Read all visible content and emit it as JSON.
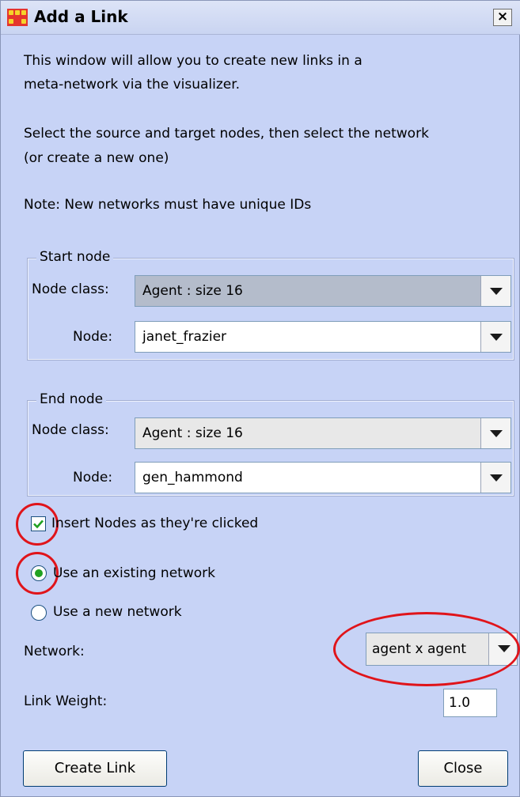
{
  "window": {
    "title": "Add a Link",
    "close_glyph": "×"
  },
  "intro": {
    "line1": "This window will allow you to create new links in a",
    "line2": "meta-network via the visualizer.",
    "line3": "Select the source and target nodes, then select the network",
    "line4": "(or create a new one)",
    "note": "Note: New networks must have unique IDs"
  },
  "start_node": {
    "title": "Start node",
    "class_label": "Node class:",
    "class_value": "Agent : size 16",
    "node_label": "Node:",
    "node_value": "janet_frazier"
  },
  "end_node": {
    "title": "End node",
    "class_label": "Node class:",
    "class_value": "Agent : size 16",
    "node_label": "Node:",
    "node_value": "gen_hammond"
  },
  "options": {
    "insert_label": "Insert Nodes as they're clicked",
    "insert_checked": true,
    "existing_label": "Use an existing network",
    "new_label": "Use a new network",
    "selected": "existing"
  },
  "network": {
    "label": "Network:",
    "value": "agent x agent"
  },
  "weight": {
    "label": "Link Weight:",
    "value": "1.0"
  },
  "buttons": {
    "create": "Create Link",
    "close": "Close"
  },
  "colors": {
    "window_bg": "#c7d3f6",
    "highlight_ring": "#e0141a",
    "check_green": "#21a121"
  }
}
